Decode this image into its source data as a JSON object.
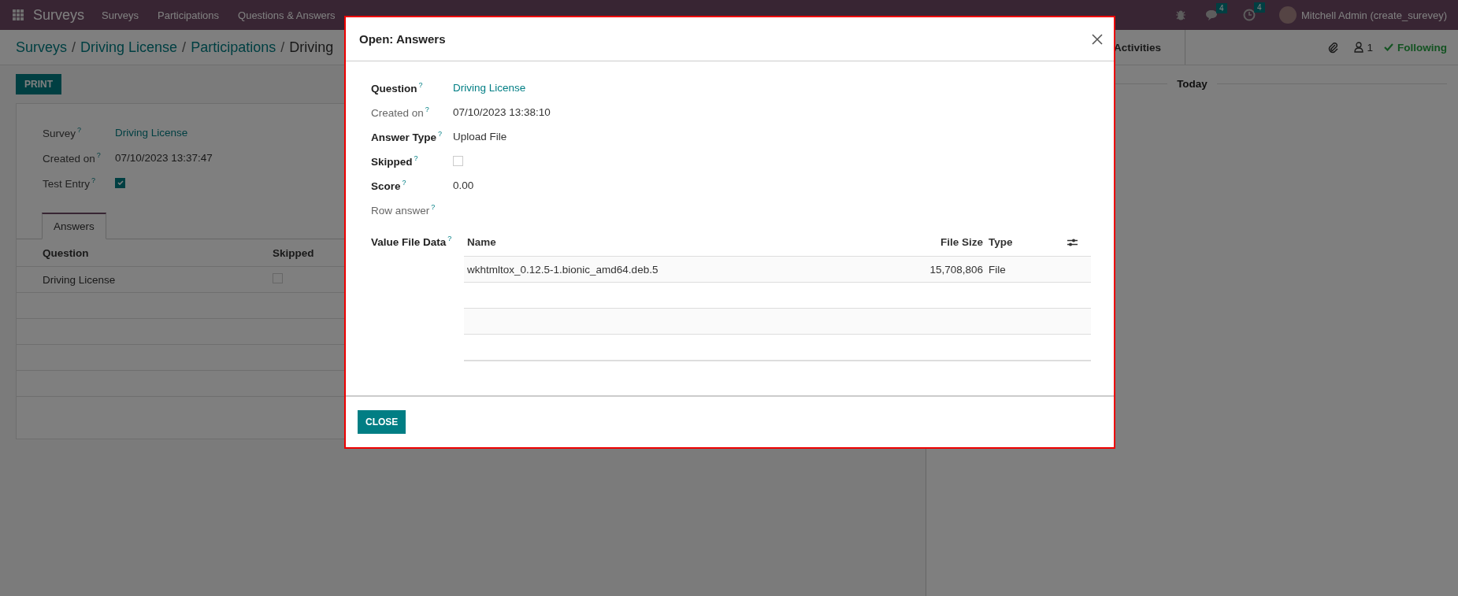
{
  "navbar": {
    "app_name": "Surveys",
    "menu": [
      "Surveys",
      "Participations",
      "Questions & Answers"
    ],
    "chat_count": "4",
    "activity_count": "4",
    "user": "Mitchell Admin (create_surevey)"
  },
  "breadcrumb": {
    "items": [
      "Surveys",
      "Driving License",
      "Participations",
      "Driving"
    ],
    "separators": [
      "/",
      "/",
      "/"
    ]
  },
  "toolbar": {
    "print_button": "PRINT"
  },
  "form": {
    "fields": [
      {
        "label": "Survey",
        "help": "?",
        "kind": "link",
        "value": "Driving License"
      },
      {
        "label": "Created on",
        "help": "?",
        "kind": "text",
        "value": "07/10/2023 13:37:47"
      },
      {
        "label": "Test Entry",
        "help": "?",
        "kind": "checkbox",
        "checked": true
      }
    ],
    "tabs": [
      {
        "label": "Answers",
        "selected": true
      }
    ],
    "table": {
      "columns": [
        "Question",
        "Skipped"
      ],
      "rows": [
        {
          "question": "Driving License",
          "skipped": false
        }
      ]
    }
  },
  "chatter": {
    "activities_button": "Activities",
    "follower_count": "1",
    "follow_button": "Following",
    "date_separator": "Today"
  },
  "dialog": {
    "title": "Open: Answers",
    "fields": [
      {
        "label": "Question",
        "help": "?",
        "emphasized": true,
        "kind": "link",
        "value": "Driving License"
      },
      {
        "label": "Created on",
        "help": "?",
        "emphasized": false,
        "kind": "text",
        "value": "07/10/2023 13:38:10"
      },
      {
        "label": "Answer Type",
        "help": "?",
        "emphasized": true,
        "kind": "text",
        "value": "Upload File"
      },
      {
        "label": "Skipped",
        "help": "?",
        "emphasized": true,
        "kind": "checkbox",
        "checked": false
      },
      {
        "label": "Score",
        "help": "?",
        "emphasized": true,
        "kind": "text",
        "value": "0.00"
      },
      {
        "label": "Row answer",
        "help": "?",
        "emphasized": false,
        "kind": "text"
      },
      {
        "label": "Value File Data",
        "help": "?",
        "emphasized": true,
        "kind": "table"
      }
    ],
    "file_table": {
      "columns": [
        "Name",
        "File Size",
        "Type"
      ],
      "rows": [
        {
          "name": "wkhtmltox_0.12.5-1.bionic_amd64.deb.5",
          "file_size": "15,708,806",
          "type": "File"
        }
      ]
    },
    "close_button": "CLOSE"
  }
}
